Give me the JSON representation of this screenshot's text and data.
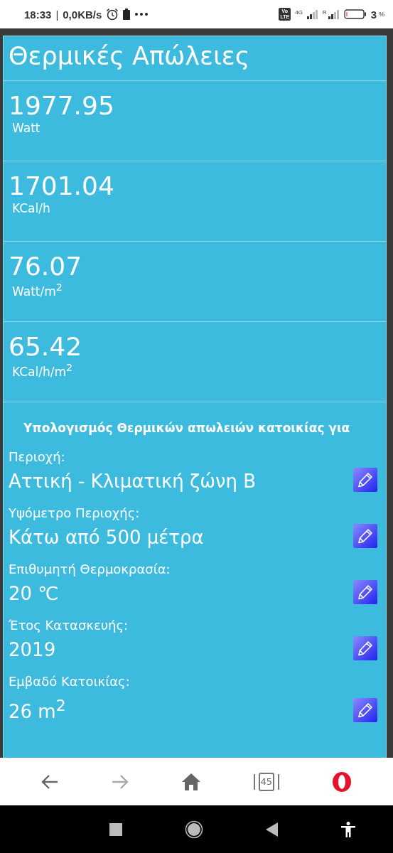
{
  "status_bar": {
    "time": "18:33",
    "separator": "|",
    "speed": "0,0KB/s",
    "volte": [
      "Vo",
      "LTE"
    ],
    "network_1": "4G",
    "network_2": "R",
    "battery": "3",
    "battery_unit": "%"
  },
  "title": "Θερμικές Απώλειες",
  "results": [
    {
      "value": "1977.95",
      "unit": "Watt"
    },
    {
      "value": "1701.04",
      "unit": "KCal/h"
    },
    {
      "value": "76.07",
      "unit": "Watt/m$^{2}$"
    },
    {
      "value": "65.42",
      "unit": "KCal/h/m$^{2}$"
    }
  ],
  "section_heading": "Υπολογισμός Θερμικών απωλειών κατοικίας για",
  "fields": [
    {
      "label": "Περιοχή:",
      "value": "Αττική - Κλιματική ζώνη Β"
    },
    {
      "label": "Υψόμετρο Περιοχής:",
      "value": "Κάτω από 500 μέτρα"
    },
    {
      "label": "Επιθυμητή Θερμοκρασία:",
      "value": "20 ℃"
    },
    {
      "label": "Έτος Κατασκευής:",
      "value": "2019"
    },
    {
      "label": "Εμβαδό Κατοικίας:",
      "value": "26 m$^{2}$"
    }
  ],
  "browser_nav": {
    "back_disabled": false,
    "forward_disabled": true,
    "tab_count": "45"
  }
}
